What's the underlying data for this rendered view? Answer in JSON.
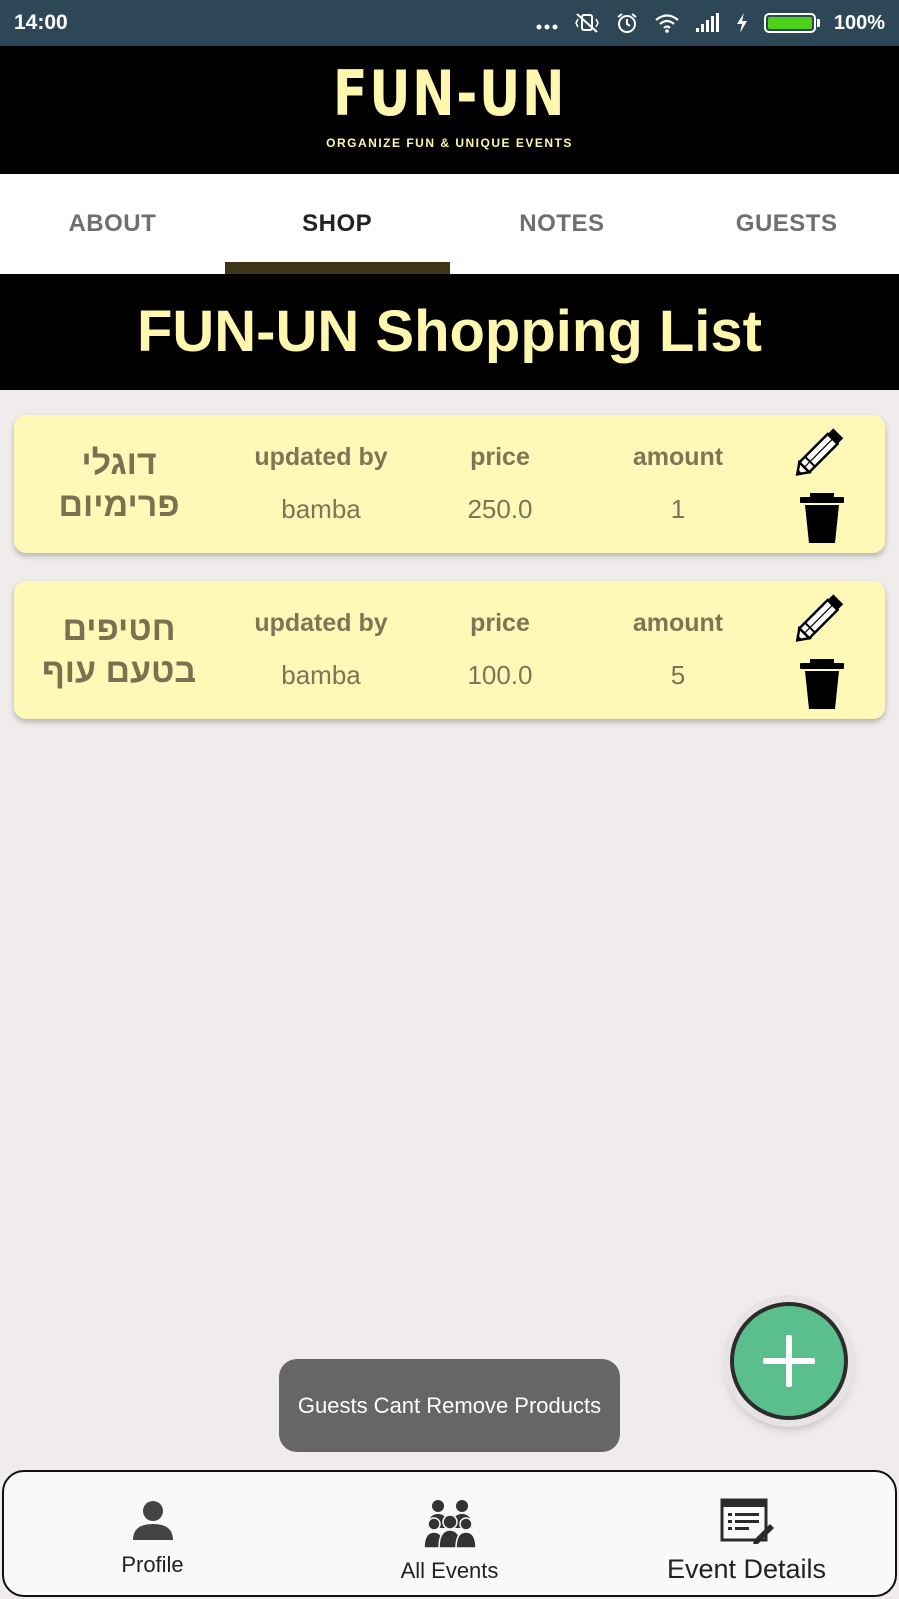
{
  "status_bar": {
    "time": "14:00",
    "battery_percent": "100%",
    "icons": [
      "more-dots-icon",
      "mute-vibrate-icon",
      "alarm-icon",
      "wifi-icon",
      "signal-icon",
      "charging-icon",
      "battery-icon"
    ]
  },
  "header": {
    "logo": "FUN-UN",
    "tagline": "ORGANIZE FUN & UNIQUE EVENTS"
  },
  "tabs": [
    {
      "label": "ABOUT",
      "active": false
    },
    {
      "label": "SHOP",
      "active": true
    },
    {
      "label": "NOTES",
      "active": false
    },
    {
      "label": "GUESTS",
      "active": false
    }
  ],
  "list_title": "FUN-UN Shopping List",
  "products": [
    {
      "name_line1": "דוגלי",
      "name_line2": "פרימיום",
      "updated_by_label": "updated by",
      "updated_by": "bamba",
      "price_label": "price",
      "price": "250.0",
      "amount_label": "amount",
      "amount": "1"
    },
    {
      "name_line1": "חטיפים",
      "name_line2": "בטעם עוף",
      "updated_by_label": "updated by",
      "updated_by": "bamba",
      "price_label": "price",
      "price": "100.0",
      "amount_label": "amount",
      "amount": "5"
    }
  ],
  "toast": "Guests Cant Remove Products",
  "fab_icon": "plus-icon",
  "bottom_nav": [
    {
      "label": "Profile",
      "icon": "person-icon"
    },
    {
      "label": "All Events",
      "icon": "group-icon"
    },
    {
      "label": "Event Details",
      "icon": "event-details-icon",
      "active": true
    }
  ],
  "colors": {
    "status_bar": "#2e4757",
    "header_bg": "#000000",
    "accent_yellow": "#fff7ad",
    "card_bg": "#fff9b8",
    "tab_indicator": "#3e3418",
    "fab": "#5bbf8d",
    "battery": "#4cd317"
  }
}
